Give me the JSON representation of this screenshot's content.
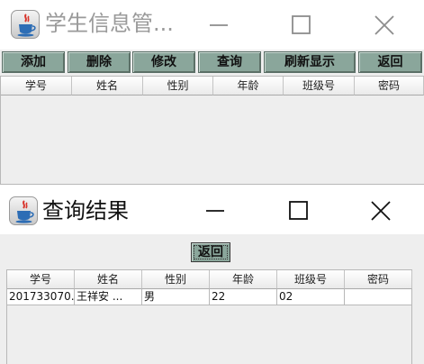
{
  "main_window": {
    "title": "学生信息管...",
    "toolbar": [
      "添加",
      "删除",
      "修改",
      "查询",
      "刷新显示",
      "返回"
    ],
    "columns": [
      "学号",
      "姓名",
      "性别",
      "年龄",
      "班级号",
      "密码"
    ]
  },
  "result_window": {
    "title": "查询结果",
    "back_label": "返回",
    "columns": [
      "学号",
      "姓名",
      "性别",
      "年龄",
      "班级号",
      "密码"
    ],
    "rows": [
      [
        "201733070...",
        "王祥安        ...",
        "男",
        "22",
        "02",
        ""
      ]
    ]
  },
  "icons": {
    "app": "java-coffee-icon",
    "minimize": "minimize-icon",
    "maximize": "maximize-icon",
    "close": "close-icon"
  },
  "colors": {
    "button_bg": "#8aa69b",
    "window_bg": "#eeeeee",
    "titlebar_bg": "#ffffff",
    "inactive_title": "#9a9a9a"
  }
}
